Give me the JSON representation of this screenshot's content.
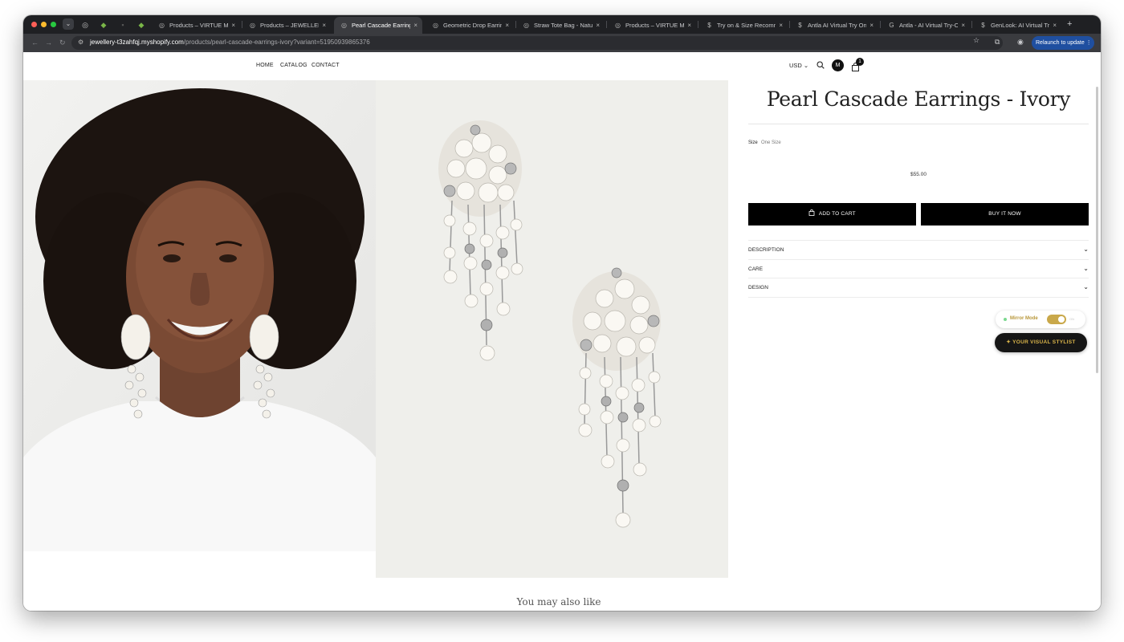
{
  "browser": {
    "tabs": [
      {
        "title": "Products – VIRTUE MIRA",
        "favicon": "globe-icon",
        "active": false
      },
      {
        "title": "Products – JEWELLERY",
        "favicon": "globe-icon",
        "active": false
      },
      {
        "title": "Pearl Cascade Earrings -",
        "favicon": "globe-icon",
        "active": true
      },
      {
        "title": "Geometric Drop Earrings",
        "favicon": "globe-icon",
        "active": false
      },
      {
        "title": "Straw Tote Bag - Natural",
        "favicon": "globe-icon",
        "active": false
      },
      {
        "title": "Products – VIRTUE MIRA",
        "favicon": "globe-icon",
        "active": false
      },
      {
        "title": "Try on & Size Recomme",
        "favicon": "dollar-icon",
        "active": false
      },
      {
        "title": "Antla AI Virtual Try On -",
        "favicon": "dollar-icon",
        "active": false
      },
      {
        "title": "Antla - AI Virtual Try-On",
        "favicon": "google-icon",
        "active": false
      },
      {
        "title": "GenLook: AI Virtual Try O",
        "favicon": "dollar-icon",
        "active": false
      }
    ],
    "url_host": "jewellery-t3zahfqj.myshopify.com",
    "url_path": "/products/pearl-cascade-earrings-ivory?variant=51950939865376",
    "relaunch_label": "Relaunch to update",
    "new_tab": "+",
    "tab_close": "×"
  },
  "nav": {
    "home": "HOME",
    "catalog": "CATALOG",
    "contact": "CONTACT",
    "currency": "USD",
    "avatar_initial": "M",
    "cart_count": "1"
  },
  "product": {
    "title": "Pearl Cascade Earrings - Ivory",
    "size_label": "Size",
    "size_value": "One Size",
    "price": "$55.00",
    "add_to_cart": "ADD TO CART",
    "buy_now": "BUY IT NOW",
    "accordions": [
      "DESCRIPTION",
      "CARE",
      "DESIGN"
    ]
  },
  "widget": {
    "mirror_label": "Mirror Mode",
    "mirror_state": "ON",
    "stylist_label": "YOUR VISUAL STYLIST"
  },
  "recommendations": {
    "heading": "You may also like"
  },
  "colors": {
    "accent_gold": "#c9a84a",
    "button_black": "#000000",
    "relaunch_blue": "#1f4fa0"
  }
}
